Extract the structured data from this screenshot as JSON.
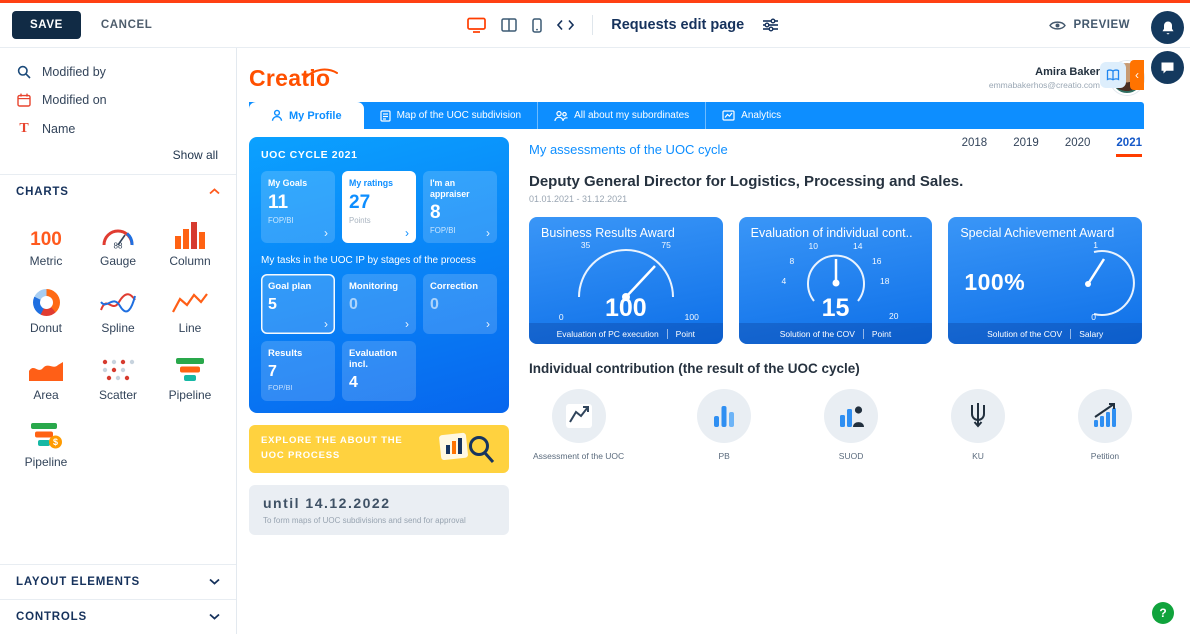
{
  "toolbar": {
    "save": "SAVE",
    "cancel": "CANCEL",
    "title": "Requests edit page",
    "preview": "PREVIEW"
  },
  "sidebar": {
    "filters": [
      {
        "label": "Modified by"
      },
      {
        "label": "Modified on"
      },
      {
        "label": "Name"
      }
    ],
    "show_all": "Show all",
    "sections": {
      "charts": "CHARTS",
      "layout": "LAYOUT ELEMENTS",
      "controls": "CONTROLS"
    },
    "tiles": [
      {
        "label": "Metric",
        "glyph": "100"
      },
      {
        "label": "Gauge",
        "glyph": "88"
      },
      {
        "label": "Column"
      },
      {
        "label": "Donut"
      },
      {
        "label": "Spline"
      },
      {
        "label": "Line"
      },
      {
        "label": "Area"
      },
      {
        "label": "Scatter"
      },
      {
        "label": "Pipeline"
      },
      {
        "label": "Pipeline"
      }
    ]
  },
  "canvas": {
    "logo": "Creatio",
    "user": {
      "name": "Amira Baker",
      "email": "emmabakerhos@creatio.com"
    },
    "tabs": [
      {
        "label": "My Profile"
      },
      {
        "label": "Map of the UOC subdivision"
      },
      {
        "label": "All about my subordinates"
      },
      {
        "label": "Analytics"
      }
    ],
    "profile": {
      "cycle_title": "UOC CYCLE 2021",
      "stats": [
        {
          "label": "My Goals",
          "value": "11",
          "sub": "FOP/BI"
        },
        {
          "label": "My ratings",
          "value": "27",
          "sub": "Points"
        },
        {
          "label": "I'm an appraiser",
          "value": "8",
          "sub": "FOP/BI"
        }
      ],
      "tasks_title": "My tasks in the UOC IP by stages of the process",
      "tasks": [
        {
          "label": "Goal plan",
          "value": "5"
        },
        {
          "label": "Monitoring",
          "value": "0"
        },
        {
          "label": "Correction",
          "value": "0"
        },
        {
          "label": "Results",
          "value": "7",
          "sub": "FOP/BI"
        },
        {
          "label": "Evaluation incl.",
          "value": "4"
        }
      ],
      "banner": "EXPLORE THE ABOUT THE UOC PROCESS",
      "deadline": {
        "title": "until 14.12.2022",
        "sub": "To form maps of UOC subdivisions and send for approval"
      }
    },
    "assessments": {
      "heading": "My assessments of the UOC cycle",
      "years": [
        "2018",
        "2019",
        "2020",
        "2021"
      ],
      "position": "Deputy General Director for Logistics, Processing and Sales.",
      "period": "01.01.2021 - 31.12.2021",
      "gauges": [
        {
          "title": "Business Results Award",
          "value": "100",
          "ticks": {
            "t1": "35",
            "t2": "75",
            "min": "0",
            "max": "100"
          },
          "footer_label": "Evaluation of PC execution",
          "footer_unit": "Point"
        },
        {
          "title": "Evaluation of individual cont..",
          "value": "15",
          "ticks": {
            "t1": "10",
            "t2": "14",
            "t3": "8",
            "t4": "16",
            "t5": "4",
            "t6": "18",
            "t7": "20"
          },
          "footer_label": "Solution of the COV",
          "footer_unit": "Point"
        },
        {
          "title": "Special Achievement Award",
          "value": "100%",
          "ticks": {
            "t1": "1",
            "t2": "0"
          },
          "footer_label": "Solution of the COV",
          "footer_unit": "Salary"
        }
      ],
      "contribution_heading": "Individual contribution (the result of the UOC cycle)",
      "contributions": [
        {
          "label": "Assessment of the UOC"
        },
        {
          "label": "PB"
        },
        {
          "label": "SUOD"
        },
        {
          "label": "KU"
        },
        {
          "label": "Petition"
        }
      ]
    }
  },
  "colors": {
    "accent_orange": "#ff4013",
    "brand_orange": "#ff5a1e",
    "primary_blue": "#0d8eff",
    "dark_navy": "#16325c",
    "help_green": "#10a33c"
  }
}
